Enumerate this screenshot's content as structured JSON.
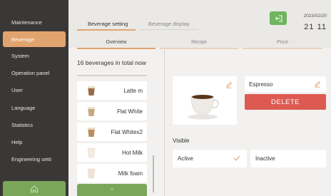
{
  "sidebar": {
    "items": [
      {
        "label": "Maintenance"
      },
      {
        "label": "Beverage",
        "active": true
      },
      {
        "label": "System"
      },
      {
        "label": "Operation panel"
      },
      {
        "label": "User"
      },
      {
        "label": "Language"
      },
      {
        "label": "Statistics"
      },
      {
        "label": "Help"
      },
      {
        "label": "Engineering setti"
      }
    ]
  },
  "header": {
    "tabs": [
      "Beverage setting",
      "Beverage display"
    ],
    "date": "2023/02/20",
    "time": "21 11"
  },
  "subtabs": [
    "Overview",
    "Recipe",
    "Price"
  ],
  "beverage_list": {
    "count_text": "16 beverages in total now",
    "items": [
      {
        "name": "Latte m",
        "icon": "latte-cup-icon"
      },
      {
        "name": "Flat White",
        "icon": "flat-white-cup-icon"
      },
      {
        "name": "Flat Whitex2",
        "icon": "flat-white-cup-icon"
      },
      {
        "name": "Hot Milk",
        "icon": "hot-milk-cup-icon"
      },
      {
        "name": "Milk foam",
        "icon": "milk-foam-cup-icon"
      }
    ],
    "add_label": "+"
  },
  "detail": {
    "name": "Espresso",
    "delete_label": "DELETE",
    "visible_label": "Visible",
    "active_label": "Active",
    "inactive_label": "Inactive",
    "visible_state": "Active"
  },
  "colors": {
    "accent": "#e2a46f",
    "green": "#7aa65a",
    "delete": "#dd5a52",
    "sidebar_bg": "#3a3836"
  }
}
